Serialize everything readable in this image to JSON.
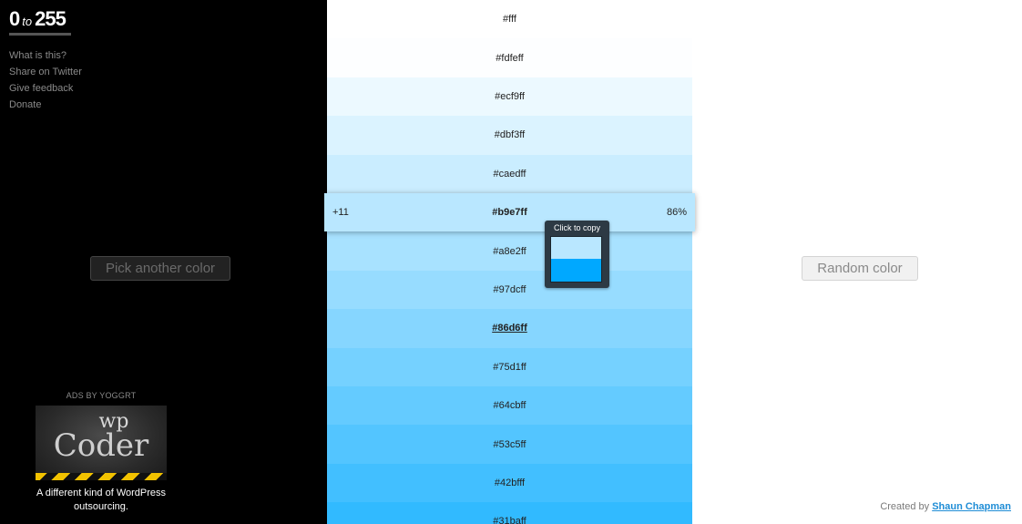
{
  "logo": {
    "zero": "0",
    "to": "to",
    "max": "255"
  },
  "menu": [
    "What is this?",
    "Share on Twitter",
    "Give feedback",
    "Donate"
  ],
  "pick_button": "Pick another color",
  "random_button": "Random color",
  "ad": {
    "label": "ADS BY YOGGRT",
    "image_text_top": "wp",
    "image_text_main": "Coder",
    "text": "A different kind of WordPress outsourcing."
  },
  "swatches": [
    {
      "hex": "#fff"
    },
    {
      "hex": "#fdfeff"
    },
    {
      "hex": "#ecf9ff"
    },
    {
      "hex": "#dbf3ff"
    },
    {
      "hex": "#caedff"
    },
    {
      "hex": "#b9e7ff",
      "selected": true,
      "offset": "+11",
      "percent": "86%"
    },
    {
      "hex": "#a8e2ff"
    },
    {
      "hex": "#97dcff"
    },
    {
      "hex": "#86d6ff",
      "original": true
    },
    {
      "hex": "#75d1ff"
    },
    {
      "hex": "#64cbff"
    },
    {
      "hex": "#53c5ff"
    },
    {
      "hex": "#42bfff"
    },
    {
      "hex": "#31baff"
    }
  ],
  "tooltip": {
    "label": "Click to copy",
    "preview_top_color": "#b9e7ff",
    "preview_bottom_color": "#00a8ff"
  },
  "credit": {
    "prefix": "Created by",
    "author": "Shaun Chapman"
  },
  "colors": {
    "left_panel": "#000000",
    "link_blue": "#1f8dd6"
  }
}
